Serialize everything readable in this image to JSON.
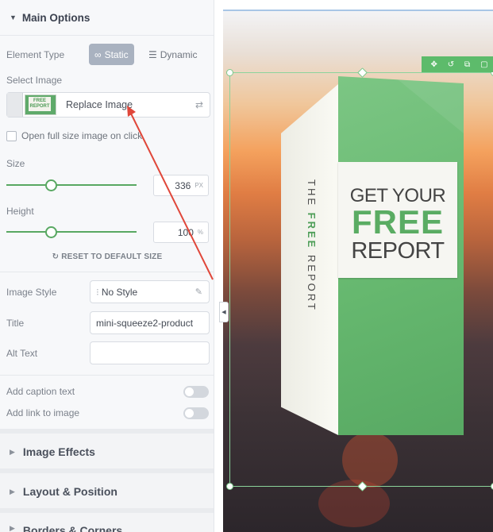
{
  "panel": {
    "main_options": "Main Options",
    "element_type_label": "Element Type",
    "static_label": "Static",
    "dynamic_label": "Dynamic",
    "select_image_label": "Select Image",
    "thumb_text": "FREE REPORT",
    "replace_image_label": "Replace Image",
    "open_full_size_label": "Open full size image on click",
    "size_label": "Size",
    "size_value": "336",
    "size_unit": "PX",
    "size_slider_fraction": 0.34,
    "height_label": "Height",
    "height_value": "100",
    "height_unit": "%",
    "height_slider_fraction": 0.34,
    "reset_label": "RESET TO DEFAULT SIZE",
    "image_style_label": "Image Style",
    "image_style_value": "No Style",
    "title_label": "Title",
    "title_value": "mini-squeeze2-product",
    "alt_text_label": "Alt Text",
    "alt_text_value": "",
    "caption_label": "Add caption text",
    "caption_on": false,
    "link_label": "Add link to image",
    "link_on": false,
    "image_effects": "Image Effects",
    "layout_position": "Layout & Position",
    "borders_corners": "Borders & Corners"
  },
  "canvas": {
    "spine_text_pre": "THE ",
    "spine_text_bold": "FREE",
    "spine_text_post": " REPORT",
    "label_line1": "GET YOUR",
    "label_line2": "FREE",
    "label_line3": "REPORT",
    "toolbar_icons": [
      "move-icon",
      "undo-icon",
      "clone-icon",
      "delete-icon"
    ]
  },
  "colors": {
    "accent_green": "#59a862",
    "annotation_red": "#e0473a"
  }
}
